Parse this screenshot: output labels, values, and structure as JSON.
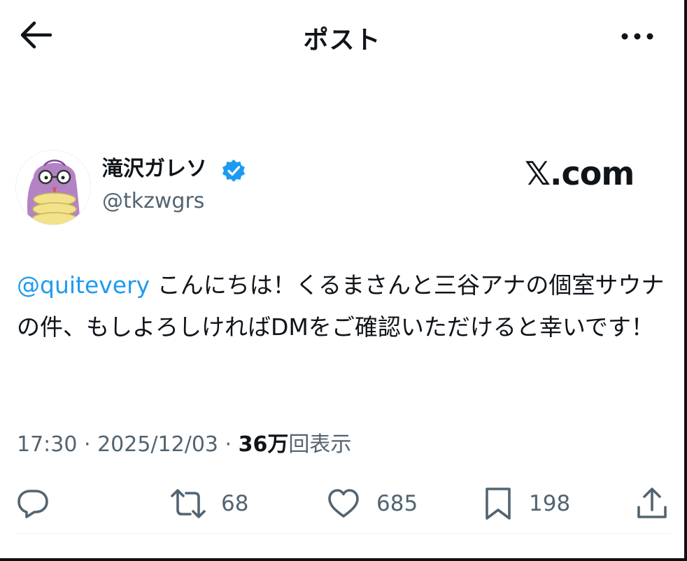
{
  "header": {
    "title": "ポスト"
  },
  "author": {
    "display_name": "滝沢ガレソ",
    "handle": "@tkzwgrs",
    "verified": true
  },
  "watermark": "𝕏.com",
  "tweet": {
    "mention": "@quitevery",
    "body": " こんにちは！くるまさんと三谷アナの個室サウナの件、もしよろしければDMをご確認いただけると幸いです！"
  },
  "meta": {
    "time": "17:30",
    "sep1": " · ",
    "date": "2025/12/03",
    "sep2": " · ",
    "views_count": "36万",
    "views_label": "回表示"
  },
  "actions": {
    "reply": {
      "icon": "reply-icon"
    },
    "repost": {
      "icon": "repost-icon",
      "count": "68"
    },
    "like": {
      "icon": "heart-icon",
      "count": "685"
    },
    "bookmark": {
      "icon": "bookmark-icon",
      "count": "198"
    },
    "share": {
      "icon": "share-icon"
    }
  },
  "colors": {
    "accent": "#1d9bf0",
    "text": "#0f1419",
    "secondary": "#536471",
    "icon": "#536471",
    "avatar_purple": "#b383c5",
    "avatar_yellow": "#f2e28a"
  }
}
